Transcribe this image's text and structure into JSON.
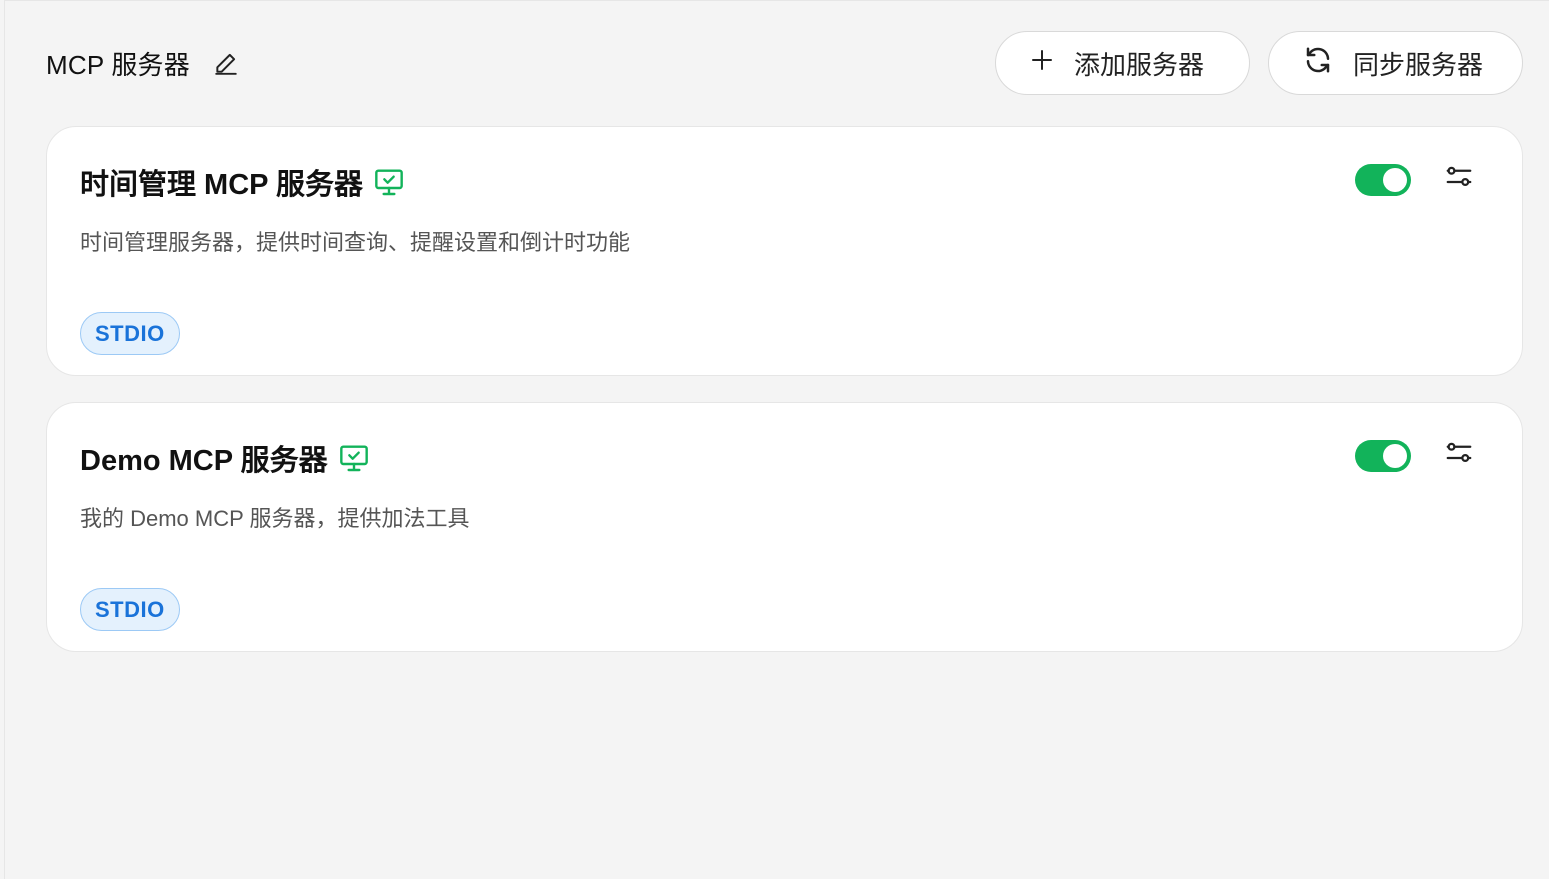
{
  "header": {
    "title": "MCP 服务器",
    "add_label": "添加服务器",
    "sync_label": "同步服务器"
  },
  "servers": [
    {
      "name": "时间管理 MCP 服务器",
      "description": "时间管理服务器，提供时间查询、提醒设置和倒计时功能",
      "transport": "STDIO",
      "enabled": true
    },
    {
      "name": "Demo MCP 服务器",
      "description": "我的 Demo MCP 服务器，提供加法工具",
      "transport": "STDIO",
      "enabled": true
    }
  ],
  "icons": {
    "edit": "pencil-icon",
    "add": "plus-icon",
    "sync": "refresh-icon",
    "status": "monitor-check-icon",
    "settings": "sliders-icon"
  },
  "colors": {
    "toggle_on": "#12b35a",
    "status_icon": "#12b35a",
    "badge_text": "#1a73d9",
    "badge_bg": "#e4f1fd",
    "badge_border": "#9cc9f5"
  }
}
